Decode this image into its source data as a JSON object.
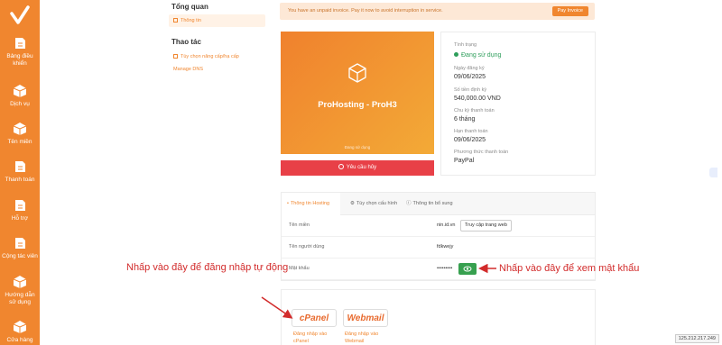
{
  "colors": {
    "primary": "#f0862f",
    "danger": "#e84047",
    "success": "#37a04f",
    "annotation": "#d22b2b"
  },
  "sidebar": {
    "logo_icon": "check-logo-icon",
    "items": [
      {
        "label": "Bảng điều khiển",
        "icon": "dashboard-icon"
      },
      {
        "label": "Dịch vụ",
        "icon": "box-icon"
      },
      {
        "label": "Tên miền",
        "icon": "globe-icon"
      },
      {
        "label": "Thanh toán",
        "icon": "wallet-icon"
      },
      {
        "label": "Hỗ trợ",
        "icon": "support-icon"
      },
      {
        "label": "Cộng tác viên",
        "icon": "affiliate-icon"
      },
      {
        "label": "Hướng dẫn sử dụng",
        "icon": "guide-icon"
      },
      {
        "label": "Cửa hàng",
        "icon": "shop-icon"
      }
    ]
  },
  "menu": {
    "overview_title": "Tổng quan",
    "overview_item": "Thông tin",
    "actions_title": "Thao tác",
    "actions": [
      "Tùy chọn nâng cấp/hạ cấp",
      "Manage DNS"
    ]
  },
  "alert": {
    "text": "You have an unpaid invoice. Pay it now to avoid interruption in service.",
    "button": "Pay Invoice"
  },
  "product": {
    "name": "ProHosting - ProH3",
    "status_small": "Đang sử dụng",
    "cancel_label": "Yêu cầu hủy"
  },
  "info": {
    "status_label": "Tình trạng",
    "status_value": "Đang sử dụng",
    "reg_date_label": "Ngày đăng ký",
    "reg_date_value": "09/06/2025",
    "amount_label": "Số tiền định kỳ",
    "amount_value": "540,000.00 VND",
    "cycle_label": "Chu kỳ thanh toán",
    "cycle_value": "6 tháng",
    "due_label": "Hạn thanh toán",
    "due_value": "09/06/2025",
    "method_label": "Phương thức thanh toán",
    "method_value": "PayPal"
  },
  "tabs": [
    "Thông tin Hosting",
    "Tùy chọn cấu hình",
    "Thông tin bổ sung"
  ],
  "hosting": {
    "domain_label": "Tên miền",
    "domain_value": "nin.id.vn",
    "visit_button": "Truy cập trang web",
    "username_label": "Tên người dùng",
    "username_value": "fdkwejy",
    "password_label": "Mật khẩu",
    "password_value": "•••••••••"
  },
  "login": {
    "cpanel_logo": "cPanel",
    "cpanel_link": [
      "Đăng nhập vào",
      "cPanel"
    ],
    "webmail_logo": "Webmail",
    "webmail_link": [
      "Đăng nhập vào",
      "Webmail"
    ]
  },
  "annotations": {
    "left": "Nhấp vào đây để đăng nhập tự động",
    "right": "Nhấp vào đây để xem mật khẩu"
  },
  "ip_address": "125.212.217.249"
}
